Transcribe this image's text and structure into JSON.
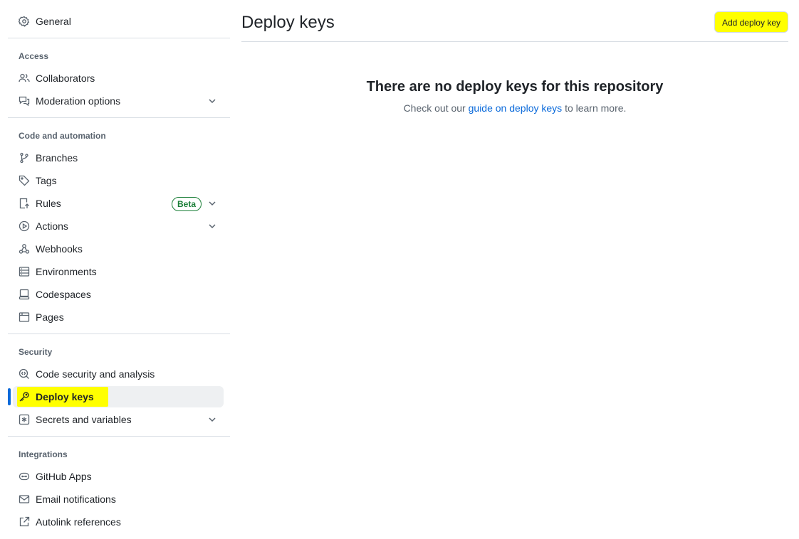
{
  "sidebar": {
    "general": {
      "label": "General",
      "icon": "gear-icon"
    },
    "sections": {
      "access": "Access",
      "code": "Code and automation",
      "security": "Security",
      "integrations": "Integrations"
    },
    "items": {
      "collaborators": "Collaborators",
      "moderation": "Moderation options",
      "branches": "Branches",
      "tags": "Tags",
      "rules": "Rules",
      "rules_badge": "Beta",
      "actions": "Actions",
      "webhooks": "Webhooks",
      "environments": "Environments",
      "codespaces": "Codespaces",
      "pages": "Pages",
      "code_security": "Code security and analysis",
      "deploy_keys": "Deploy keys",
      "secrets": "Secrets and variables",
      "github_apps": "GitHub Apps",
      "email": "Email notifications",
      "autolink": "Autolink references"
    }
  },
  "main": {
    "title": "Deploy keys",
    "add_button": "Add deploy key",
    "blank_title": "There are no deploy keys for this repository",
    "blank_prefix": "Check out our",
    "blank_link": "guide on deploy keys",
    "blank_suffix": "to learn more."
  },
  "colors": {
    "highlight": "#ffff00",
    "accent": "#0969da",
    "badge_green": "#1a7f37"
  }
}
